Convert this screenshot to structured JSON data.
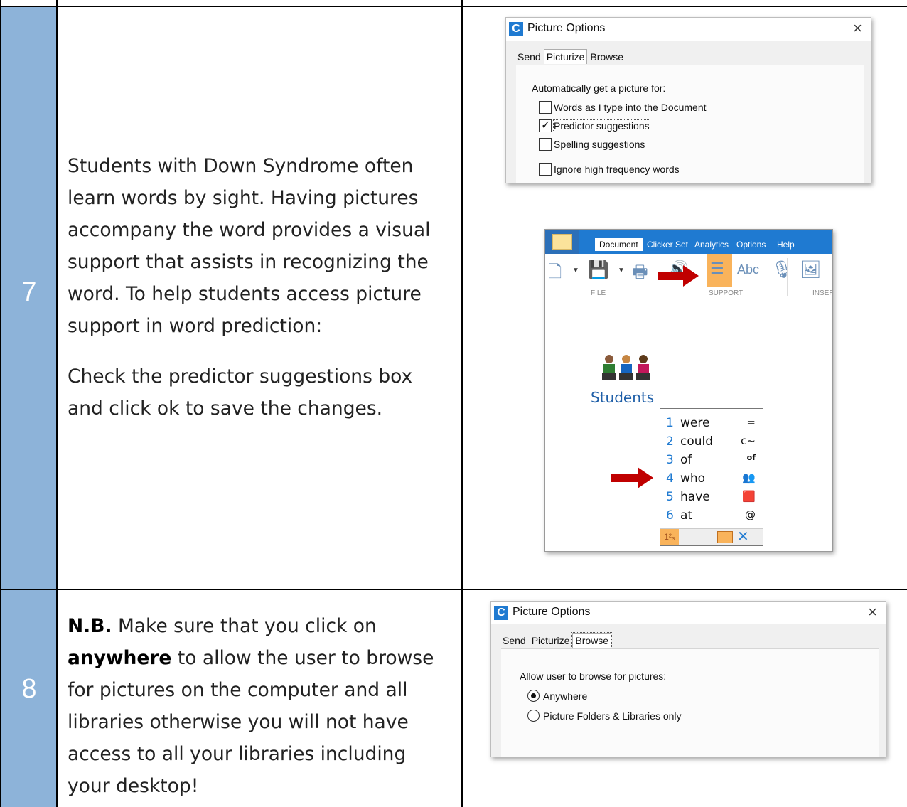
{
  "steps": [
    {
      "number": "7",
      "paragraphs": [
        "Students with Down Syndrome often learn words by sight. Having pictures accompany the word provides a visual support that assists in recognizing the word. To help students access picture support in word prediction:",
        "Check the predictor suggestions box and click ok to save the changes."
      ]
    },
    {
      "number": "8",
      "nb_label": "N.B.",
      "text_before": " Make sure that you click on ",
      "bold_word": "anywhere",
      "text_after": " to allow the user to browse for pictures on the computer and all libraries otherwise you will not have access to all your libraries including your desktop!"
    }
  ],
  "dialog1": {
    "title": "Picture Options",
    "logo": "C",
    "close": "×",
    "tabs": [
      "Send",
      "Picturize",
      "Browse"
    ],
    "active_tab": "Picturize",
    "heading": "Automatically get a picture for:",
    "options": [
      {
        "label": "Words as I type into the Document",
        "checked": false
      },
      {
        "label": "Predictor suggestions",
        "checked": true
      },
      {
        "label": "Spelling suggestions",
        "checked": false
      },
      {
        "label": "Ignore high frequency words",
        "checked": false
      }
    ]
  },
  "dialog2": {
    "title": "Picture Options",
    "logo": "C",
    "close": "×",
    "tabs": [
      "Send",
      "Picturize",
      "Browse"
    ],
    "active_tab": "Browse",
    "heading": "Allow user to browse for pictures:",
    "options": [
      {
        "label": "Anywhere",
        "selected": true
      },
      {
        "label": "Picture Folders & Libraries only",
        "selected": false
      }
    ]
  },
  "app": {
    "menus": [
      "Document",
      "Clicker Set",
      "Analytics",
      "Options",
      "Help"
    ],
    "active_menu": "Document",
    "ribbon_groups": [
      "FILE",
      "SUPPORT",
      "INSER"
    ],
    "typed_word": "Students",
    "predictions": [
      {
        "num": "1",
        "word": "were",
        "symbol": "="
      },
      {
        "num": "2",
        "word": "could",
        "symbol": "c~"
      },
      {
        "num": "3",
        "word": "of",
        "symbol": "of"
      },
      {
        "num": "4",
        "word": "who",
        "symbol": "👥"
      },
      {
        "num": "5",
        "word": "have",
        "symbol": "🟥"
      },
      {
        "num": "6",
        "word": "at",
        "symbol": "@"
      }
    ],
    "footer_label": "1²₃"
  },
  "colors": {
    "step_column": "#8db3d9",
    "accent_blue": "#1f7ad1",
    "arrow_red": "#c00000",
    "highlight_orange": "#f9b35b"
  }
}
